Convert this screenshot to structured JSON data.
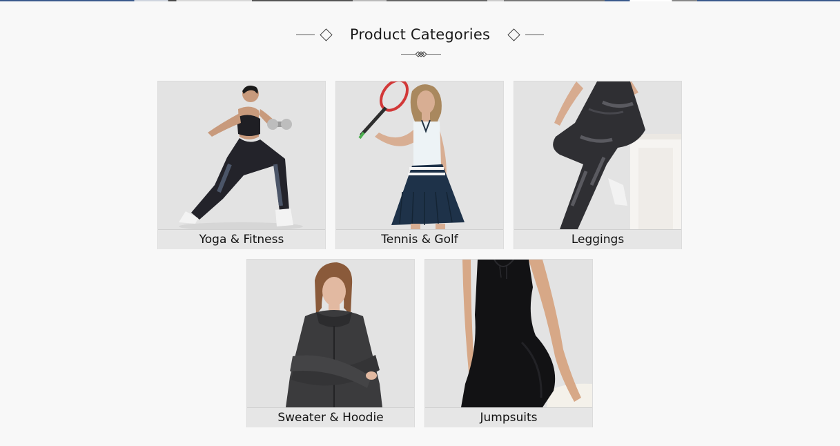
{
  "section": {
    "title": "Product Categories"
  },
  "categories": [
    {
      "name": "Yoga & Fitness",
      "image": "woman-lunging-with-dumbbell"
    },
    {
      "name": "Tennis & Golf",
      "image": "woman-with-tennis-racket"
    },
    {
      "name": "Leggings",
      "image": "legs-in-grey-leggings"
    },
    {
      "name": "Sweater & Hoodie",
      "image": "woman-in-grey-hoodie"
    },
    {
      "name": "Jumpsuits",
      "image": "woman-in-black-jumpsuit"
    }
  ],
  "colors": {
    "background": "#f8f8f8",
    "label_bar": "#e6e6e6",
    "heading_text": "#1a1a1a"
  }
}
